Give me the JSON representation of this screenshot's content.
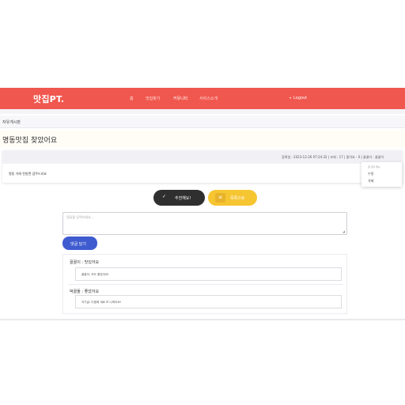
{
  "header": {
    "logo": "맛집PT.",
    "nav": [
      {
        "label": "홈",
        "active": false
      },
      {
        "label": "맛집찾기",
        "active": false
      },
      {
        "label": "커뮤니티",
        "active": true
      },
      {
        "label": "서비스소개",
        "active": false
      }
    ],
    "logout_label": "Logout",
    "colors": {
      "brand": "#f0574e",
      "accent": "#f6c532"
    }
  },
  "board": {
    "label": "자유게시판"
  },
  "post": {
    "title": "명동맛집 찾았어요",
    "meta": "등록일 : 2023-12-26 07:24:32 | 조회 : 17 | 좋아요 : 0 | 꿀꿀이 : 꿀꿀이",
    "body": "명동 거래 된방면 검주드리요",
    "author_menu": {
      "header": "글 관리 메뉴",
      "items": [
        "수정",
        "삭제"
      ]
    }
  },
  "actions": {
    "recommend_label": "추천해요!",
    "list_label": "목록으로"
  },
  "comment_form": {
    "placeholder": "댓글을 입력하세요...",
    "submit_label": "댓글 달기"
  },
  "comments": [
    {
      "author_line": "꿀꿀이 : 맛있어요",
      "reply": "꿀꿀이: 저도 좋았어요!"
    },
    {
      "author_line": "박꿀돌 : 좋았어요",
      "reply": "자기글: 다음에 새로 또 나와아요!"
    }
  ]
}
